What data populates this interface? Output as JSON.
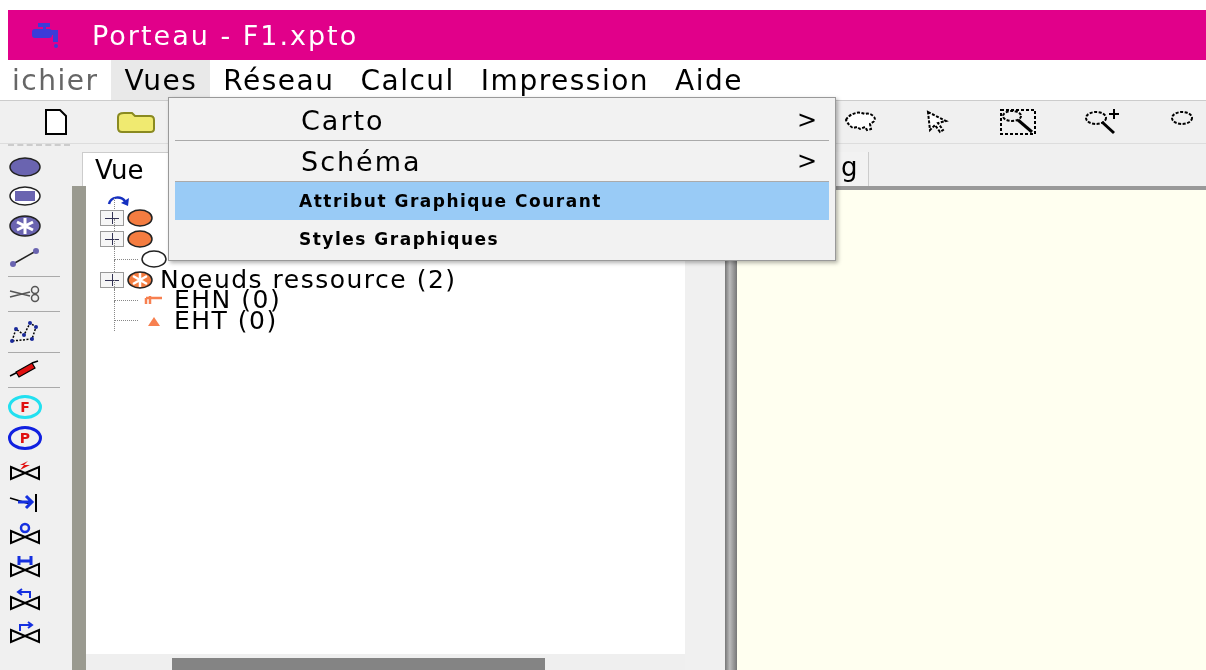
{
  "window": {
    "title": "Porteau - F1.xpto"
  },
  "menu_bar": [
    {
      "label": "ichier",
      "selected": false
    },
    {
      "label": "Vues",
      "selected": true
    },
    {
      "label": "Réseau",
      "selected": false
    },
    {
      "label": "Calcul",
      "selected": false
    },
    {
      "label": "Impression",
      "selected": false
    },
    {
      "label": "Aide",
      "selected": false
    }
  ],
  "open_menu": [
    {
      "label": "Carto",
      "kind": "submenu",
      "selected": false,
      "arrow": ">"
    },
    {
      "label": "Schéma",
      "kind": "submenu",
      "selected": false,
      "arrow": ">"
    },
    {
      "label": "Attribut Graphique Courant",
      "kind": "action",
      "selected": true
    },
    {
      "label": "Styles Graphiques",
      "kind": "action",
      "selected": false
    }
  ],
  "tool_palette": [
    {
      "kind": "ellipse"
    },
    {
      "kind": "rect"
    },
    {
      "kind": "star"
    },
    {
      "kind": "line"
    },
    {
      "kind": "sep"
    },
    {
      "kind": "scissors"
    },
    {
      "kind": "sep"
    },
    {
      "kind": "polygon"
    },
    {
      "kind": "sep"
    },
    {
      "kind": "syringe"
    },
    {
      "kind": "sep"
    },
    {
      "kind": "letter",
      "text": "F",
      "color": "#22e0f0"
    },
    {
      "kind": "letter",
      "text": "P",
      "color": "#1020e0"
    },
    {
      "kind": "bolt"
    },
    {
      "kind": "arrowbar"
    },
    {
      "kind": "quality"
    },
    {
      "kind": "hydrant"
    },
    {
      "kind": "back"
    },
    {
      "kind": "forward"
    }
  ],
  "left_tabs": [
    {
      "label": "Vue",
      "selected": true
    }
  ],
  "right_tabs": [
    {
      "label": "g",
      "selected": false
    }
  ],
  "tree": {
    "items": [
      {
        "kind": "node",
        "expanded": false
      },
      {
        "kind": "node",
        "expanded": false
      },
      {
        "kind": "ring"
      },
      {
        "label": "Noeuds ressource (2)",
        "kind": "star",
        "expanded": false
      },
      {
        "label": "EHN (0)",
        "kind": "tap"
      },
      {
        "label": "EHT (0)",
        "kind": "triangle"
      }
    ]
  }
}
